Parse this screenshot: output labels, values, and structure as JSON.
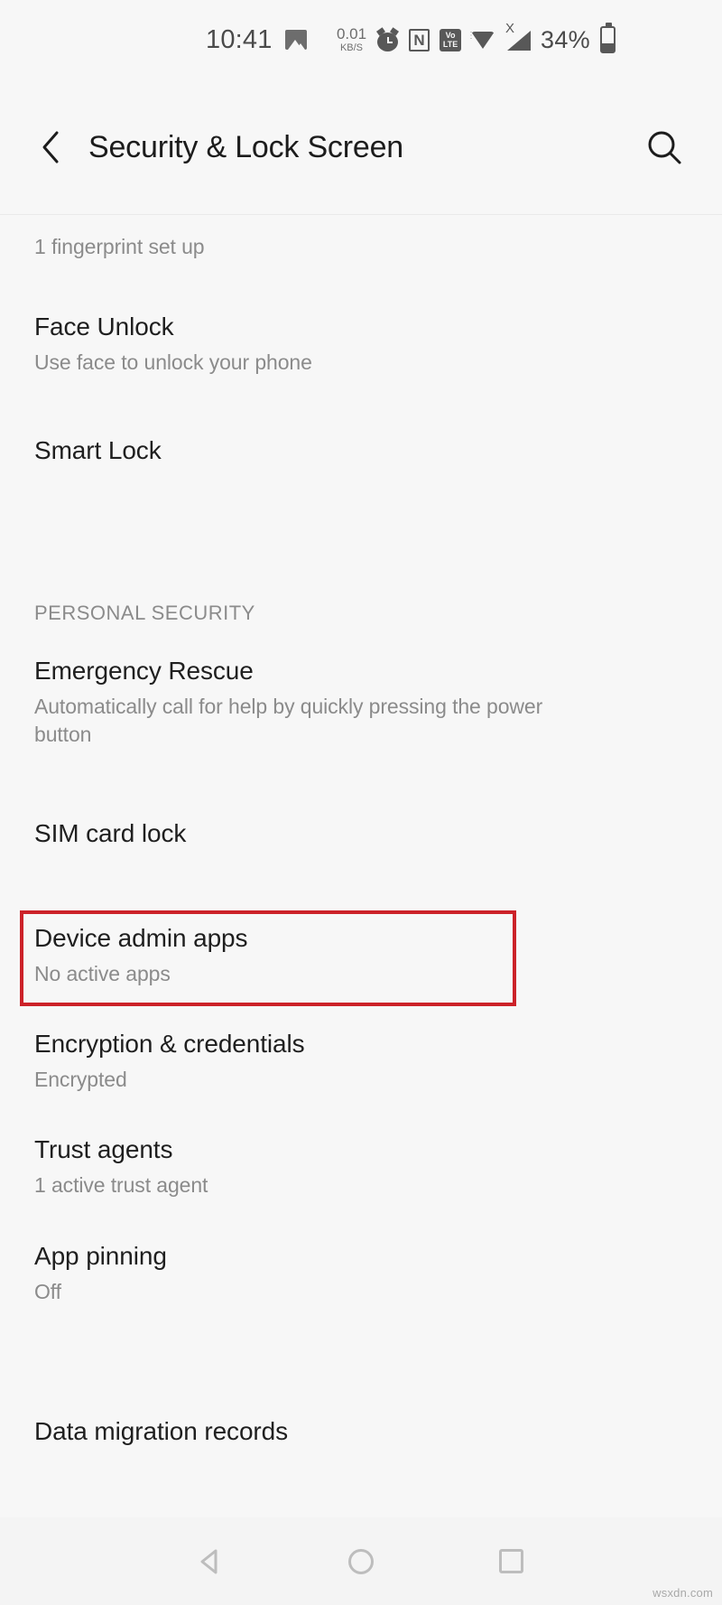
{
  "status_bar": {
    "time": "10:41",
    "photo_icon": "photo-icon",
    "network_speed_value": "0.01",
    "network_speed_unit": "KB/S",
    "alarm_icon": "alarm-icon",
    "nfc_icon_label": "N",
    "volte_top": "VoLTE",
    "volte_line1": "Vo",
    "volte_line2": "LTE",
    "wifi_icon": "wifi-icon",
    "signal_icon": "signal-no-sim-icon",
    "signal_badge": "X",
    "battery_percent": "34%",
    "battery_icon": "battery-icon"
  },
  "app_bar": {
    "back_icon": "back-chevron-icon",
    "title": "Security & Lock Screen",
    "search_icon": "search-icon"
  },
  "list": [
    {
      "id": "fingerprint",
      "title": "",
      "sub": "1 fingerprint set up"
    },
    {
      "id": "face-unlock",
      "title": "Face Unlock",
      "sub": "Use face to unlock your phone"
    },
    {
      "id": "smart-lock",
      "title": "Smart Lock",
      "sub": ""
    }
  ],
  "section_personal_security": {
    "label": "PERSONAL SECURITY"
  },
  "personal_security_items": [
    {
      "id": "emergency-rescue",
      "title": "Emergency Rescue",
      "sub": "Automatically call for help by quickly pressing the power button"
    },
    {
      "id": "sim-card-lock",
      "title": "SIM card lock",
      "sub": ""
    },
    {
      "id": "device-admin-apps",
      "title": "Device admin apps",
      "sub": "No active apps",
      "highlighted": true
    },
    {
      "id": "encryption-credentials",
      "title": "Encryption & credentials",
      "sub": "Encrypted"
    },
    {
      "id": "trust-agents",
      "title": "Trust agents",
      "sub": "1 active trust agent"
    },
    {
      "id": "app-pinning",
      "title": "App pinning",
      "sub": "Off"
    },
    {
      "id": "data-migration-records",
      "title": "Data migration records",
      "sub": ""
    }
  ],
  "annotation": {
    "highlight_color": "#cc2229",
    "target": "Device admin apps"
  },
  "nav_bar": {
    "back": "nav-back-icon",
    "home": "nav-home-icon",
    "recents": "nav-recents-icon"
  },
  "watermark": "wsxdn.com"
}
